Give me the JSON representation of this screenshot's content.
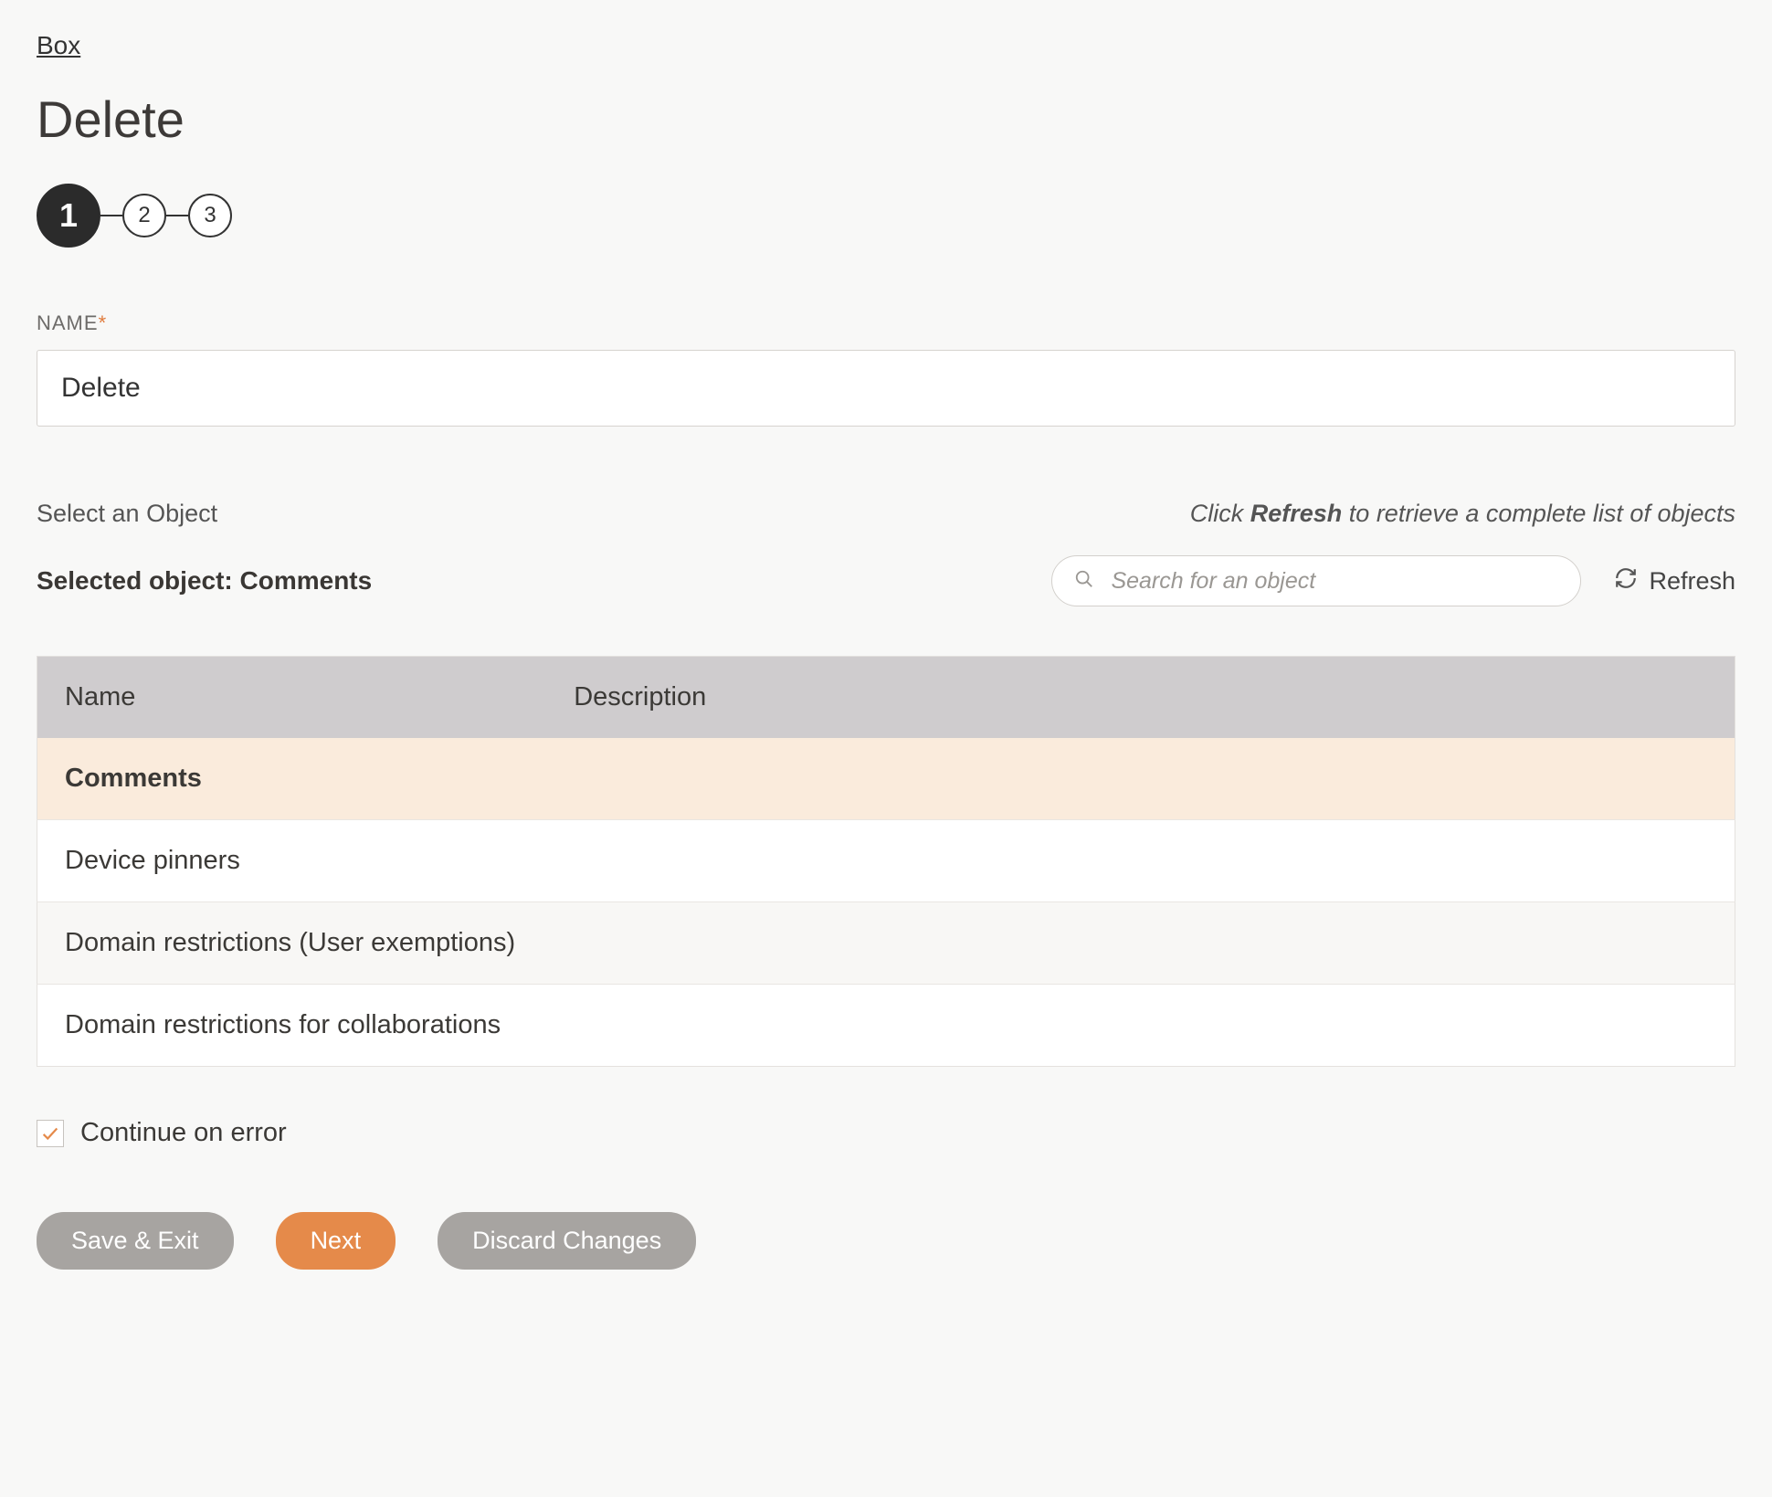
{
  "breadcrumb": {
    "label": "Box"
  },
  "title": "Delete",
  "stepper": {
    "current": 1,
    "steps": [
      "1",
      "2",
      "3"
    ]
  },
  "name_field": {
    "label": "NAME",
    "required_mark": "*",
    "value": "Delete"
  },
  "select": {
    "label": "Select an Object",
    "hint_prefix": "Click ",
    "hint_bold": "Refresh",
    "hint_suffix": " to retrieve a complete list of objects",
    "selected_label": "Selected object: Comments",
    "search_placeholder": "Search for an object",
    "refresh_label": "Refresh"
  },
  "table": {
    "columns": [
      "Name",
      "Description"
    ],
    "rows": [
      {
        "name": "Comments",
        "description": "",
        "selected": true
      },
      {
        "name": "Device pinners",
        "description": ""
      },
      {
        "name": "Domain restrictions (User exemptions)",
        "description": ""
      },
      {
        "name": "Domain restrictions for collaborations",
        "description": ""
      }
    ]
  },
  "continue_on_error": {
    "label": "Continue on error",
    "checked": true
  },
  "actions": {
    "save_exit": "Save & Exit",
    "next": "Next",
    "discard": "Discard Changes"
  },
  "colors": {
    "accent": "#e58a4a"
  }
}
